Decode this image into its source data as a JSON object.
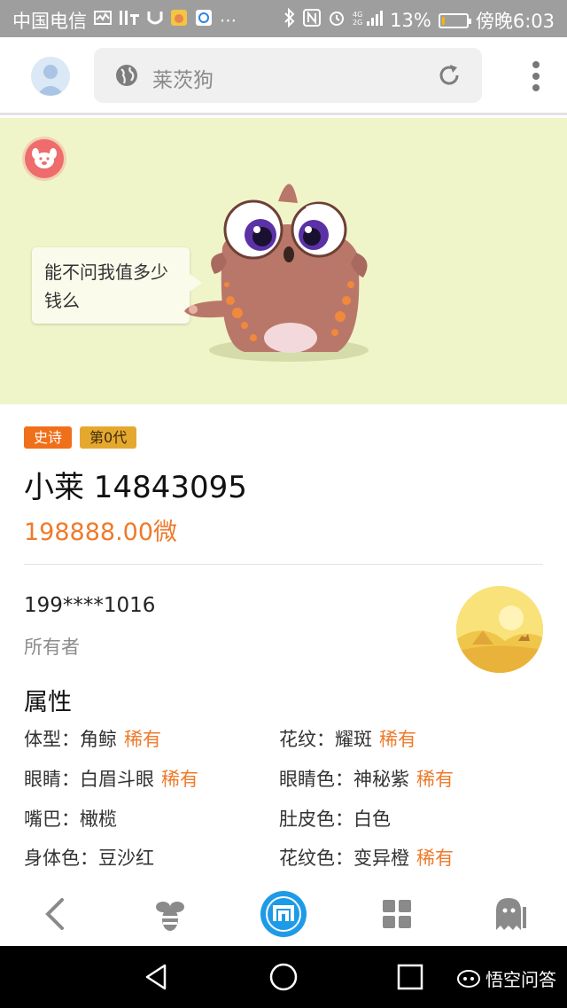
{
  "status_bar": {
    "carrier": "中国电信",
    "battery_percent": "13%",
    "battery_level": 0.13,
    "time": "傍晚6:03"
  },
  "address_bar": {
    "url_text": "莱茨狗"
  },
  "hero": {
    "speech": "能不问我值多少钱么",
    "bg_color": "#f0f5c9"
  },
  "pet": {
    "tags": [
      "史诗",
      "第0代"
    ],
    "name": "小莱 14843095",
    "price": "198888.00微"
  },
  "owner": {
    "phone": "199****1016",
    "label": "所有者"
  },
  "attributes": {
    "title": "属性",
    "rare_label": "稀有",
    "items": [
      {
        "key": "体型：",
        "value": "角鲸",
        "rare": "稀有"
      },
      {
        "key": "花纹：",
        "value": "耀斑",
        "rare": "稀有"
      },
      {
        "key": "眼睛：",
        "value": "白眉斗眼",
        "rare": "稀有"
      },
      {
        "key": "眼睛色：",
        "value": "神秘紫",
        "rare": "稀有"
      },
      {
        "key": "嘴巴：",
        "value": "橄榄",
        "rare": ""
      },
      {
        "key": "肚皮色：",
        "value": "白色",
        "rare": ""
      },
      {
        "key": "身体色：",
        "value": "豆沙红",
        "rare": ""
      },
      {
        "key": "花纹色：",
        "value": "变异橙",
        "rare": "稀有"
      }
    ]
  },
  "watermark": "悟空问答",
  "colors": {
    "accent_orange": "#ef7a2b",
    "toolbar_blue": "#1e9be8"
  }
}
